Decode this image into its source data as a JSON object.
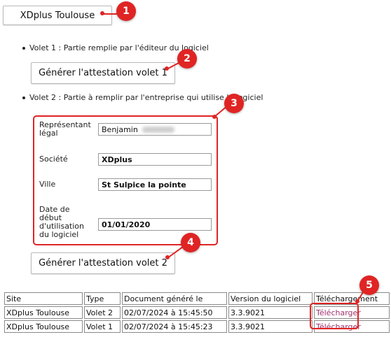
{
  "site_button": "XDplus Toulouse",
  "volet1": {
    "text": "Volet 1 : Partie remplie par l'éditeur du logiciel",
    "button": "Générer l'attestation volet 1"
  },
  "volet2": {
    "text": "Volet 2 : Partie à remplir par l'entreprise qui utilise le logiciel",
    "button": "Générer l'attestation volet 2"
  },
  "form": {
    "representant": {
      "label": "Représentant légal",
      "value": "Benjamin"
    },
    "societe": {
      "label": "Société",
      "value": "XDplus"
    },
    "ville": {
      "label": "Ville",
      "value": "St Sulpice la pointe"
    },
    "date_debut": {
      "label": "Date de début d'utilisation du logiciel",
      "value": "01/01/2020"
    }
  },
  "table": {
    "headers": [
      "Site",
      "Type",
      "Document généré le",
      "Version du logiciel",
      "Téléchargement"
    ],
    "rows": [
      [
        "XDplus Toulouse",
        "Volet 2",
        "02/07/2024 à 15:45:50",
        "3.3.9021",
        "Télécharger"
      ],
      [
        "XDplus Toulouse",
        "Volet 1",
        "02/07/2024 à 15:45:23",
        "3.3.9021",
        "Télécharger"
      ]
    ]
  },
  "badges": [
    "1",
    "2",
    "3",
    "4",
    "5"
  ],
  "colors": {
    "annotation_red": "#e02424",
    "link": "#a0326e"
  }
}
